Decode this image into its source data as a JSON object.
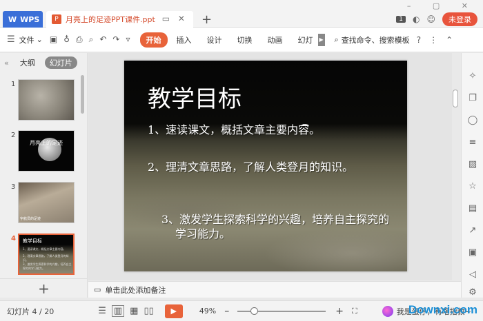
{
  "titlebar": {
    "app_tab": "WPS",
    "doc_tab": "月亮上的足迹PPT课件.ppt",
    "new_tab_icon": "+",
    "page_badge": "1",
    "login": "未登录"
  },
  "menubar": {
    "file": "文件",
    "tabs": [
      "开始",
      "插入",
      "设计",
      "切换",
      "动画",
      "幻灯"
    ],
    "active_tab": "开始",
    "search": "查找命令、搜索模板",
    "help": "?"
  },
  "leftpanel": {
    "tab_outline": "大纲",
    "tab_slides": "幻灯片",
    "thumbs": [
      {
        "num": "1"
      },
      {
        "num": "2",
        "title": "月亮上的足迹"
      },
      {
        "num": "3",
        "caption": "宇航员的足迹"
      },
      {
        "num": "4",
        "title": "教学目标"
      }
    ],
    "add": "+"
  },
  "slide": {
    "title": "教学目标",
    "points": [
      "1、速读课文，概括文章主要内容。",
      "2、理清文章思路，了解人类登月的知识。",
      "3、激发学生探索科学的兴趣，培养自主探究的学习能力。"
    ]
  },
  "notes": {
    "placeholder": "单击此处添加备注"
  },
  "statusbar": {
    "slide_info": "幻灯片 4 / 20",
    "zoom": "49%",
    "zoom_fraction": 0.49,
    "assistant": "我是蛋仔，有啥指教~"
  },
  "watermark": "Downxi.com",
  "colors": {
    "accent": "#e8633a",
    "wps_blue": "#3a6fd8",
    "login_red": "#e8543c"
  }
}
